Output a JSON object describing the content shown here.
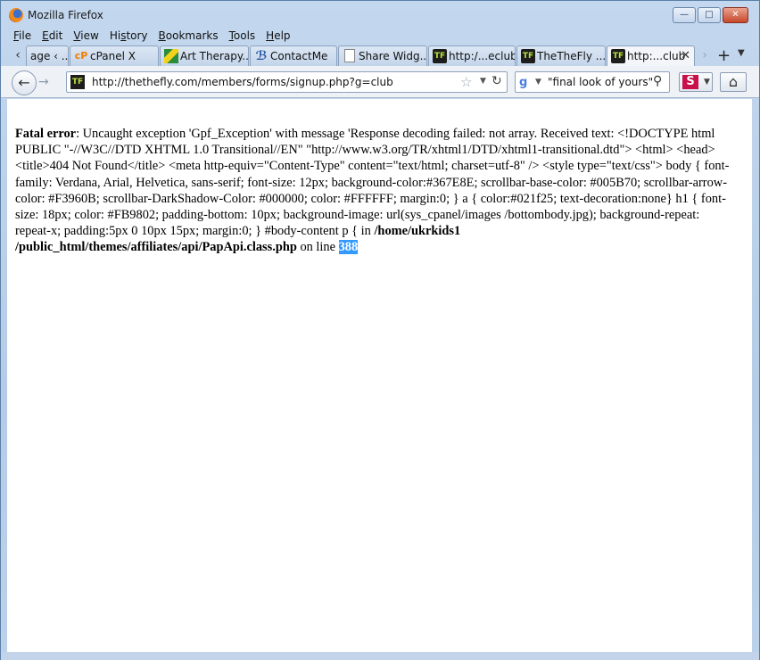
{
  "window": {
    "title": "Mozilla Firefox"
  },
  "menu": [
    {
      "pre": "",
      "key": "F",
      "rest": "ile"
    },
    {
      "pre": "",
      "key": "E",
      "rest": "dit"
    },
    {
      "pre": "",
      "key": "V",
      "rest": "iew"
    },
    {
      "pre": "Hi",
      "key": "s",
      "rest": "tory"
    },
    {
      "pre": "",
      "key": "B",
      "rest": "ookmarks"
    },
    {
      "pre": "",
      "key": "T",
      "rest": "ools"
    },
    {
      "pre": "",
      "key": "H",
      "rest": "elp"
    }
  ],
  "tabs": [
    {
      "label": "age ‹ ...",
      "icon": "page-icon"
    },
    {
      "label": "cPanel X",
      "icon": "cpanel-icon"
    },
    {
      "label": "Art Therapy...",
      "icon": "art-therapy-icon"
    },
    {
      "label": "ContactMe",
      "icon": "contactme-icon"
    },
    {
      "label": "Share Widg...",
      "icon": "document-icon"
    },
    {
      "label": "http:/...eclub",
      "icon": "thethefly-icon"
    },
    {
      "label": "TheTheFly ...",
      "icon": "thethefly-icon"
    },
    {
      "label": "http:...club",
      "icon": "thethefly-icon",
      "active": true
    }
  ],
  "nav": {
    "url": "http://thethefly.com/members/forms/signup.php?g=club",
    "search_value": "\"final look of yours\""
  },
  "favicon_text": "TF",
  "error": {
    "label": "Fatal error",
    "message": ": Uncaught exception 'Gpf_Exception' with message 'Response decoding failed: not array. Received text: <!DOCTYPE html PUBLIC \"-//W3C//DTD XHTML 1.0 Transitional//EN\" \"http://www.w3.org/TR/xhtml1/DTD/xhtml1-transitional.dtd\"> <html> <head> <title>404 Not Found</title> <meta http-equiv=\"Content-Type\" content=\"text/html; charset=utf-8\" /> <style type=\"text/css\"> body { font-family: Verdana, Arial, Helvetica, sans-serif; font-size: 12px; background-color:#367E8E; scrollbar-base-color: #005B70; scrollbar-arrow-color: #F3960B; scrollbar-DarkShadow-Color: #000000; color: #FFFFFF; margin:0; } a { color:#021f25; text-decoration:none} h1 { font-size: 18px; color: #FB9802; padding-bottom: 10px; background-image: url(sys_cpanel/images /bottombody.jpg); background-repeat: repeat-x; padding:5px 0 10px 15px; margin:0; } #body-content p { in ",
    "file": "/home/ukrkids1 /public_html/themes/affiliates/api/PapApi.class.php",
    "on_line": " on line ",
    "line_number": "388"
  }
}
